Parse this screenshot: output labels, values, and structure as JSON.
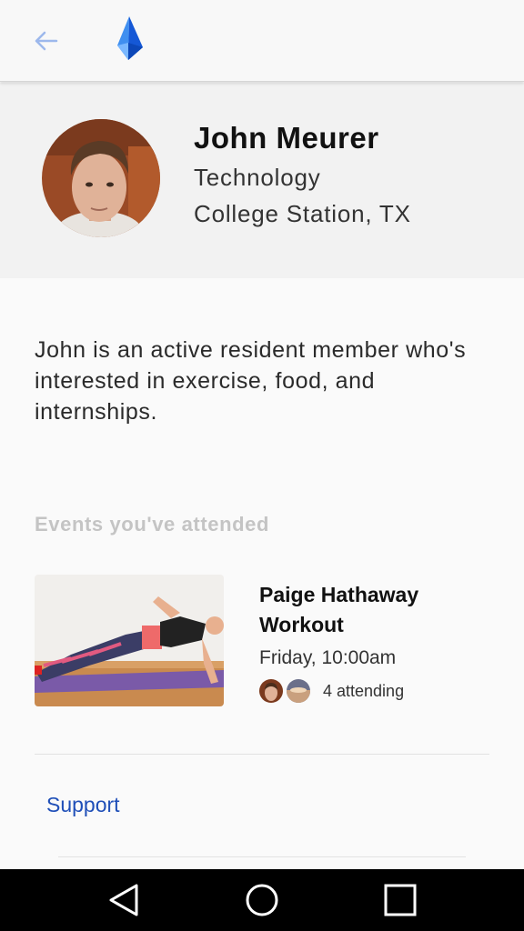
{
  "appbar": {
    "back_icon": "arrow-left-icon",
    "logo_icon": "blue-crystal-logo-icon",
    "accent_color": "#1a73e8"
  },
  "profile": {
    "name": "John Meurer",
    "department": "Technology",
    "location": "College Station, TX"
  },
  "bio": "John is an active resident member who's interested in exercise, food, and internships.",
  "events": {
    "section_title": "Events you've attended",
    "items": [
      {
        "title": "Paige Hathaway Workout",
        "time": "Friday, 10:00am",
        "attending": "4 attending"
      }
    ]
  },
  "support_link": "Support",
  "navbar": {
    "back_icon": "nav-back-icon",
    "home_icon": "nav-home-icon",
    "recents_icon": "nav-recents-icon"
  }
}
